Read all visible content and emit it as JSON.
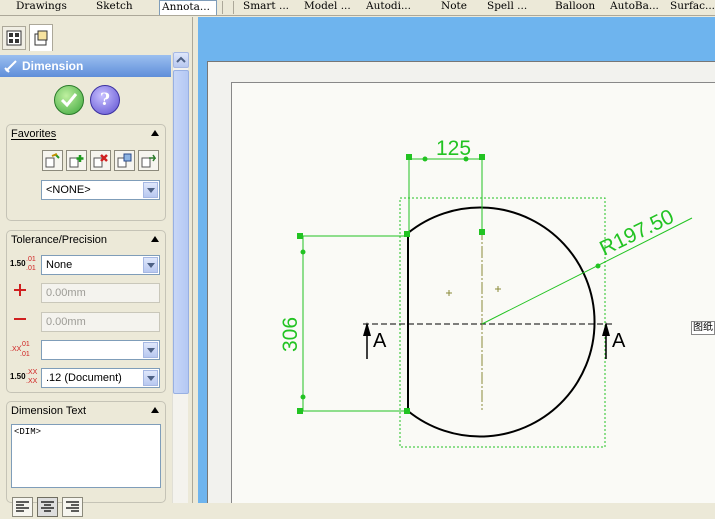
{
  "command_tabs": [
    {
      "label": "Drawings"
    },
    {
      "label": "Sketch"
    },
    {
      "label": "Annota..."
    },
    {
      "label": "Smart ..."
    },
    {
      "label": "Model ..."
    },
    {
      "label": "Autodi..."
    },
    {
      "label": "Note"
    },
    {
      "label": "Spell ..."
    },
    {
      "label": "Balloon"
    },
    {
      "label": "AutoBa..."
    },
    {
      "label": "Surfac..."
    }
  ],
  "property_manager": {
    "title": "Dimension",
    "ok_icon": "check-icon",
    "help_icon": "question-icon",
    "help_label": "?",
    "favorites": {
      "title": "Favorites",
      "selected": "<NONE>"
    },
    "tolerance": {
      "title": "Tolerance/Precision",
      "type": "None",
      "plus_value": "0.00mm",
      "minus_value": "0.00mm",
      "tolerance_precision": "",
      "primary_precision": ".12 (Document)",
      "icon_150": "1.50",
      "icon_01": ".01",
      "icon_xx": ".XX"
    },
    "dimension_text": {
      "title": "Dimension Text",
      "value": "<DIM>"
    }
  },
  "drawing": {
    "dim_horizontal": "125",
    "dim_vertical": "306",
    "dim_radius": "R197.50",
    "section_label_left": "A",
    "section_label_right": "A",
    "side_label": "图纸"
  }
}
